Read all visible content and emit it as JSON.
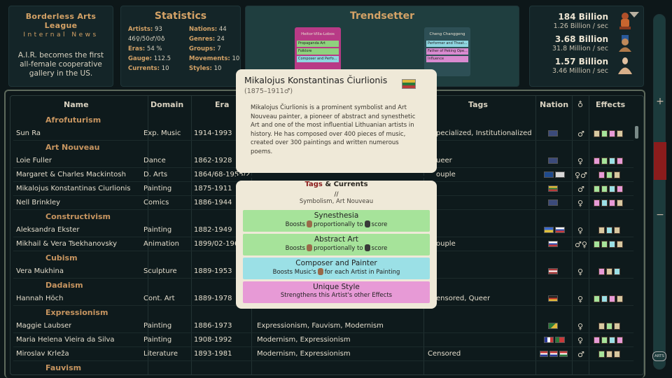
{
  "news": {
    "title": "Borderless Arts League",
    "subtitle": "Internal News",
    "body": "A.I.R. becomes the first all-female cooperative gallery in the US."
  },
  "stats": {
    "title": "Statistics",
    "artists_label": "Artists:",
    "artists": "93",
    "nations_label": "Nations:",
    "nations": "44",
    "gender_line": "46♀/50♂/0♁",
    "genres_label": "Genres:",
    "genres": "24",
    "eras_label": "Eras:",
    "eras": "54 %",
    "groups_label": "Groups:",
    "groups": "7",
    "gauge_label": "Gauge:",
    "gauge": "112.5",
    "movements_label": "Movements:",
    "movements": "10",
    "currents_label": "Currents:",
    "currents": "10",
    "styles_label": "Styles:",
    "styles": "10"
  },
  "trendsetter": {
    "title": "Trendsetter",
    "card_left": {
      "name": "Heitor-Villa-Lobos",
      "tags": [
        "Propaganda Art",
        "Folklore",
        "Composer and Perfo..."
      ],
      "color": "#b83a86"
    },
    "card_right": {
      "name": "Cheng Changgeng",
      "tags": [
        "Performer and Theat...",
        "Father of Peking Ope...",
        "Influence"
      ],
      "color": "#2d4f55"
    }
  },
  "resources": {
    "rows": [
      {
        "big": "184 Billion",
        "small": "1.26 Billion / sec",
        "icon": "figurine-icon"
      },
      {
        "big": "3.68 Billion",
        "small": "31.8 Million / sec",
        "icon": "bust-icon"
      },
      {
        "big": "1.57 Billion",
        "small": "3.46 Million / sec",
        "icon": "statue-icon"
      }
    ]
  },
  "sidebar": {
    "plus": "+",
    "minus": "−",
    "logo": "ARTS"
  },
  "table": {
    "headers": {
      "name": "Name",
      "domain": "Domain",
      "era": "Era",
      "tags": "Tags",
      "nation": "Nation",
      "gender": "♁",
      "effects": "Effects"
    },
    "groups": [
      "Afrofuturism",
      "Art Nouveau",
      "Constructivism",
      "Cubism",
      "Dadaism",
      "Expressionism",
      "Fauvism"
    ],
    "rows": [
      {
        "name": "Sun Ra",
        "domain": "Exp. Music",
        "era": "1914-1993",
        "tags": "pecialized, Institutionalized",
        "gender": "♂",
        "flags": [
          "#3b4a7a"
        ]
      },
      {
        "name": "Loie Fuller",
        "domain": "Dance",
        "era": "1862-1928",
        "tags": "ueer",
        "gender": "♀",
        "flags": [
          "#3b4a7a"
        ]
      },
      {
        "name": "Margaret & Charles Mackintosh",
        "domain": "D. Arts",
        "era": "1864/68-1955/2",
        "tags": "ouple",
        "gender": "♀♂",
        "flags": [
          "#1f4a8c",
          "#d8d8d8"
        ]
      },
      {
        "name": "Mikalojus Konstantinas Čiurlionis",
        "domain": "Painting",
        "era": "1875-1911",
        "tags": "",
        "gender": "♂",
        "flags": [
          "#c9a43a"
        ]
      },
      {
        "name": "Nell Brinkley",
        "domain": "Comics",
        "era": "1886-1944",
        "tags": "",
        "gender": "♀",
        "flags": [
          "#3b4a7a"
        ]
      },
      {
        "name": "Aleksandra Ekster",
        "domain": "Painting",
        "era": "1882-1949",
        "tags": "",
        "gender": "♀",
        "flags": [
          "#3a6ad0",
          "#d8d8d8"
        ]
      },
      {
        "name": "Mikhail & Vera Tsekhanovsky",
        "domain": "Animation",
        "era": "1899/02-1965",
        "tags": "ouple",
        "gender": "♂♀",
        "flags": [
          "#d8d8d8"
        ]
      },
      {
        "name": "Vera Mukhina",
        "domain": "Sculpture",
        "era": "1889-1953",
        "tags": "",
        "gender": "♀",
        "flags": [
          "#a83a3a"
        ]
      },
      {
        "name": "Hannah Höch",
        "domain": "Cont. Art",
        "era": "1889-1978",
        "tags": "ensored, Queer",
        "gender": "♀",
        "flags": [
          "#c83a2a"
        ]
      },
      {
        "name": "Maggie Laubser",
        "domain": "Painting",
        "era": "1886-1973",
        "tags": "Expressionism, Fauvism, Modernism",
        "gender": "♀",
        "flags": [
          "#2a7a3a"
        ]
      },
      {
        "name": "Maria Helena Vieira da Silva",
        "domain": "Painting",
        "era": "1908-1992",
        "tags": "Modernism, Expressionism",
        "gender": "♀",
        "flags": [
          "#2a3a9a",
          "#2a7a3a"
        ]
      },
      {
        "name": "Miroslav Krleža",
        "domain": "Literature",
        "era": "1893-1981",
        "tags2": "Modernism, Expressionism",
        "tags": "Censored",
        "gender": "♂",
        "flags": [
          "#c83a3a",
          "#c83a3a",
          "#c83a3a"
        ]
      }
    ]
  },
  "popup": {
    "name": "Mikalojus Konstantinas Čiurlionis",
    "years": "(1875–1911♂)",
    "description": "Mikalojus Čiurlionis is a prominent symbolist and Art Nouveau painter, a pioneer of abstract and synesthetic Art and one of the most influential Lithuanian artists in history. He has composed over 400 pieces of music, created over 300 paintings and written numerous poems.",
    "tags_label": "Tags",
    "amp": "&",
    "currents_label": "Currents",
    "slash": "//",
    "tag_values": "Symbolism, Art Nouveau",
    "effects": [
      {
        "title": "Synesthesia",
        "desc_a": "Boosts",
        "desc_b": "proportionally to",
        "desc_c": "score",
        "color": "#a6e39a"
      },
      {
        "title": "Abstract Art",
        "desc_a": "Boosts",
        "desc_b": "proportionally to",
        "desc_c": "score",
        "color": "#a6e39a"
      },
      {
        "title": "Composer and Painter",
        "desc_a": "Boosts Music's",
        "desc_b": "for each Artist in Painting",
        "desc_c": "",
        "color": "#9be0e6"
      },
      {
        "title": "Unique Style",
        "desc_a": "Strengthens this Artist's other Effects",
        "desc_b": "",
        "desc_c": "",
        "color": "#e79ad6"
      }
    ]
  }
}
